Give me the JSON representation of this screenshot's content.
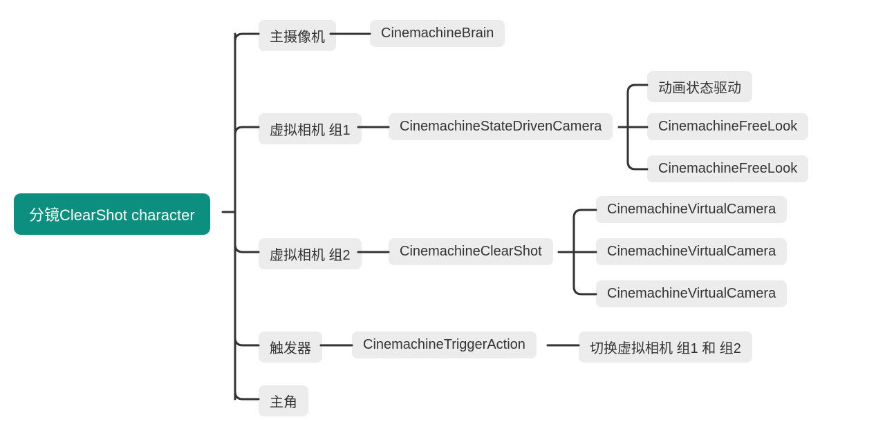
{
  "root": {
    "label": "分镜ClearShot character"
  },
  "level1": {
    "camera": {
      "label": "主摄像机"
    },
    "group1": {
      "label": "虚拟相机 组1"
    },
    "group2": {
      "label": "虚拟相机 组2"
    },
    "trigger": {
      "label": "触发器"
    },
    "protagonist": {
      "label": "主角"
    }
  },
  "level2": {
    "brain": {
      "label": "CinemachineBrain"
    },
    "stateDriven": {
      "label": "CinemachineStateDrivenCamera"
    },
    "clearShot": {
      "label": "CinemachineClearShot"
    },
    "triggerAction": {
      "label": "CinemachineTriggerAction"
    }
  },
  "level3": {
    "animState": {
      "label": "动画状态驱动"
    },
    "freeLook1": {
      "label": "CinemachineFreeLook"
    },
    "freeLook2": {
      "label": "CinemachineFreeLook"
    },
    "vCam1": {
      "label": "CinemachineVirtualCamera"
    },
    "vCam2": {
      "label": "CinemachineVirtualCamera"
    },
    "vCam3": {
      "label": "CinemachineVirtualCamera"
    },
    "switchGroups": {
      "label": "切换虚拟相机 组1 和 组2"
    }
  }
}
